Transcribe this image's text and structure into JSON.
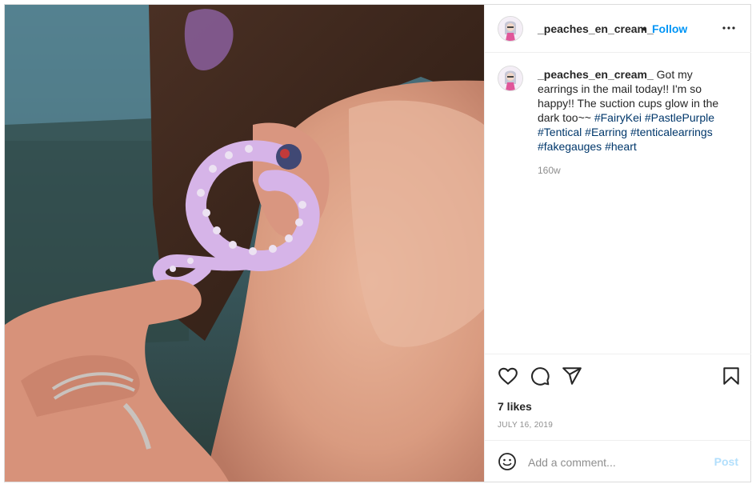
{
  "post": {
    "image_alt": "Photo of a person wearing a pastel purple tentacle earring",
    "author": {
      "username": "_peaches_en_cream_",
      "follow_label": "Follow",
      "separator": "•"
    },
    "caption": {
      "username": "_peaches_en_cream_",
      "text": "Got my earrings in the mail today!! I'm so happy!! The suction cups glow in the dark too~~",
      "hashtags": [
        "#FairyKei",
        "#PastlePurple",
        "#Tentical",
        "#Earring",
        "#tenticalearrings",
        "#fakegauges",
        "#heart"
      ],
      "age": "160w"
    },
    "likes": "7 likes",
    "date": "JULY 16, 2019",
    "comment": {
      "placeholder": "Add a comment...",
      "post_label": "Post"
    },
    "icons": {
      "more": "more-options-icon",
      "like": "heart-icon",
      "comment": "comment-icon",
      "share": "share-icon",
      "save": "bookmark-icon",
      "emoji": "emoji-icon"
    },
    "colors": {
      "follow": "#0095f6",
      "hashtag": "#00376b",
      "post_disabled": "#b2dffc",
      "secondary_text": "#8e8e8e",
      "earring": "#d6b4e8"
    }
  }
}
